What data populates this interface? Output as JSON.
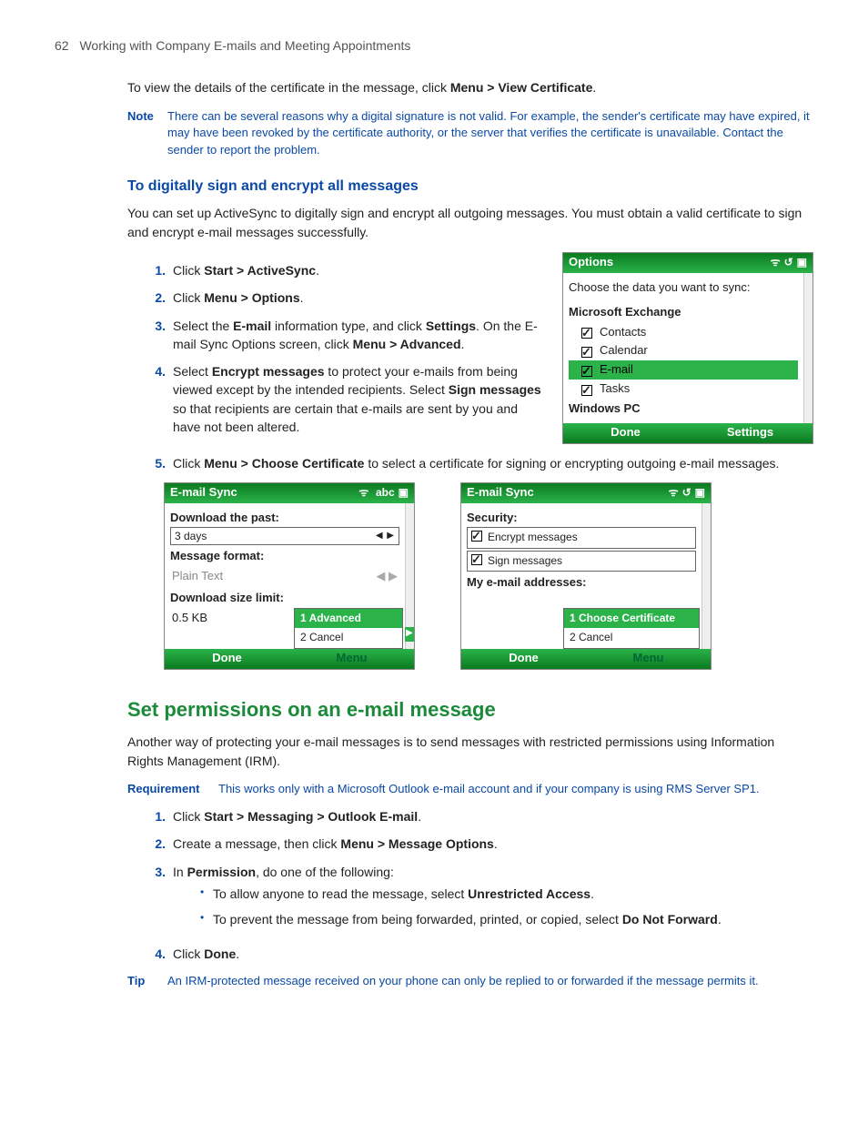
{
  "header": {
    "page_num": "62",
    "chapter": "Working with Company E-mails and Meeting Appointments"
  },
  "intro_sentence": {
    "pre": "To view the details of the certificate in the message, click ",
    "bold": "Menu > View Certificate",
    "post": "."
  },
  "note": {
    "label": "Note",
    "text": "There can be several reasons why a digital signature is not valid. For example, the sender's certificate may have expired, it may have been revoked by the certificate authority, or the server that verifies the certificate is unavailable. Contact the sender to report the problem."
  },
  "subhead1": "To digitally sign and encrypt all messages",
  "para1": "You can set up ActiveSync to digitally sign and encrypt all outgoing messages. You must obtain a valid certificate to sign and encrypt e-mail messages successfully.",
  "steps1": {
    "s1": {
      "num": "1.",
      "pre": "Click ",
      "b": "Start > ActiveSync",
      "post": "."
    },
    "s2": {
      "num": "2.",
      "pre": "Click ",
      "b": "Menu > Options",
      "post": "."
    },
    "s3": {
      "num": "3.",
      "pre": "Select the ",
      "b1": "E-mail",
      "mid": " information type, and click ",
      "b2": "Settings",
      "post1": ". On the E-mail Sync Options screen, click ",
      "b3": "Menu > Advanced",
      "post2": "."
    },
    "s4": {
      "num": "4.",
      "pre": "Select ",
      "b1": "Encrypt messages",
      "mid1": " to protect your e-mails from being viewed except by the intended recipients. Select ",
      "b2": "Sign messages",
      "post": " so that recipients are certain that e-mails are sent by you and have not been altered."
    },
    "s5": {
      "num": "5.",
      "pre": "Click ",
      "b": "Menu > Choose Certificate",
      "post": " to select a certificate for signing or encrypting outgoing e-mail messages."
    }
  },
  "phone_options": {
    "title": "Options",
    "prompt": "Choose the data you want to sync:",
    "group1": "Microsoft Exchange",
    "items": {
      "contacts": "Contacts",
      "calendar": "Calendar",
      "email": "E-mail",
      "tasks": "Tasks"
    },
    "group2": "Windows PC",
    "sk_left": "Done",
    "sk_right": "Settings"
  },
  "phone_sync_left": {
    "title": "E-mail Sync",
    "abc": "abc",
    "f1": "Download the past:",
    "v1": "3 days",
    "f2": "Message format:",
    "v2": "Plain Text",
    "f3": "Download size limit:",
    "v3": "0.5 KB",
    "menu1": "1 Advanced",
    "menu2": "2 Cancel",
    "sk_left": "Done",
    "sk_right": "Menu"
  },
  "phone_sync_right": {
    "title": "E-mail Sync",
    "f1": "Security:",
    "opt1": "Encrypt messages",
    "opt2": "Sign messages",
    "f2": "My e-mail addresses:",
    "menu1": "1 Choose Certificate",
    "menu2": "2 Cancel",
    "sk_left": "Done",
    "sk_right": "Menu"
  },
  "h2": "Set permissions on an e-mail message",
  "para2": "Another way of protecting your e-mail messages is to send messages with restricted permissions using Information Rights Management (IRM).",
  "req": {
    "label": "Requirement",
    "text": "This works only with a Microsoft Outlook e-mail account and if your company is using RMS Server SP1."
  },
  "steps2": {
    "s1": {
      "num": "1.",
      "pre": "Click ",
      "b": "Start > Messaging > Outlook E-mail",
      "post": "."
    },
    "s2": {
      "num": "2.",
      "pre": "Create a message, then click ",
      "b": "Menu > Message Options",
      "post": "."
    },
    "s3": {
      "num": "3.",
      "pre": "In ",
      "b": "Permission",
      "post": ", do one of the following:"
    },
    "bul1": {
      "pre": "To allow anyone to read the message, select ",
      "b": "Unrestricted Access",
      "post": "."
    },
    "bul2": {
      "pre": "To prevent the message from being forwarded, printed, or copied, select ",
      "b": "Do Not Forward",
      "post": "."
    },
    "s4": {
      "num": "4.",
      "pre": "Click ",
      "b": "Done",
      "post": "."
    }
  },
  "tip": {
    "label": "Tip",
    "text": "An IRM-protected message received on your phone can only be replied to or forwarded if the message permits it."
  }
}
